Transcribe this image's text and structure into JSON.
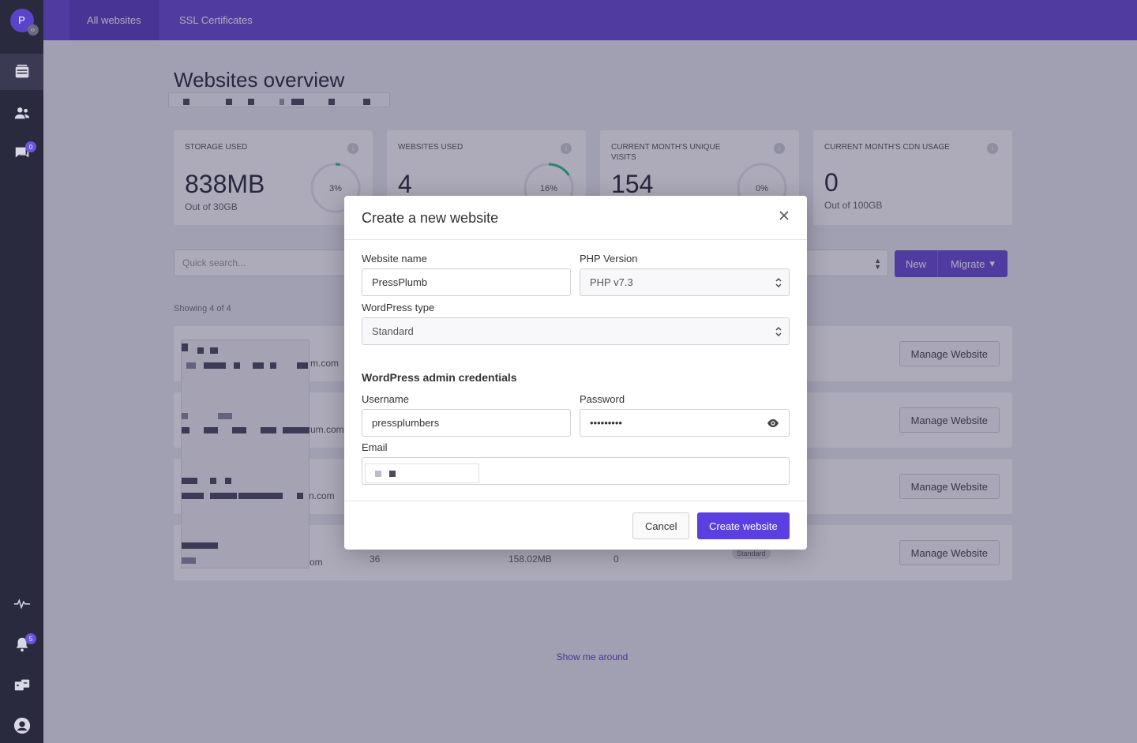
{
  "sidebar": {
    "avatar_letter": "P",
    "avatar_badge": "‹›",
    "messages_badge": "0",
    "notifications_badge": "5"
  },
  "topbar": {
    "tabs": [
      {
        "label": "All websites"
      },
      {
        "label": "SSL Certificates"
      }
    ]
  },
  "page": {
    "title": "Websites overview",
    "showing": "Showing 4 of 4",
    "search_placeholder": "Quick search...",
    "new_label": "New",
    "migrate_label": "Migrate",
    "show_around": "Show me around"
  },
  "stats": [
    {
      "label": "STORAGE USED",
      "value": "838MB",
      "sub": "Out of 30GB",
      "percent_text": "3%",
      "percent": 3
    },
    {
      "label": "WEBSITES USED",
      "value": "4",
      "sub": "",
      "percent_text": "16%",
      "percent": 16
    },
    {
      "label": "CURRENT MONTH'S UNIQUE VISITS",
      "value": "154",
      "sub": "",
      "percent_text": "0%",
      "percent": 0
    },
    {
      "label": "CURRENT MONTH'S CDN USAGE",
      "value": "0",
      "sub": "Out of 100GB"
    }
  ],
  "sites": [
    {
      "domain_suffix": "m.com",
      "manage_label": "Manage Website"
    },
    {
      "domain_suffix": "um.com",
      "manage_label": "Manage Website"
    },
    {
      "domain_suffix": "n.com",
      "manage_label": "Manage Website"
    },
    {
      "domain_suffix": "om",
      "visits": "36",
      "storage": "158.02MB",
      "cdn": "0",
      "plan": "Standard",
      "manage_label": "Manage Website"
    }
  ],
  "modal": {
    "title": "Create a new website",
    "website_name_label": "Website name",
    "website_name_value": "PressPlumb",
    "php_version_label": "PHP Version",
    "php_version_value": "PHP v7.3",
    "wp_type_label": "WordPress type",
    "wp_type_value": "Standard",
    "credentials_heading": "WordPress admin credentials",
    "username_label": "Username",
    "username_value": "pressplumbers",
    "password_label": "Password",
    "password_mask": "•••••••••",
    "email_label": "Email",
    "cancel_label": "Cancel",
    "create_label": "Create website"
  },
  "colors": {
    "accent": "#6a4cd8",
    "primary_button": "#5b3fe0",
    "sidebar": "#2a2a3e",
    "ring_progress": "#2bbf8a"
  }
}
